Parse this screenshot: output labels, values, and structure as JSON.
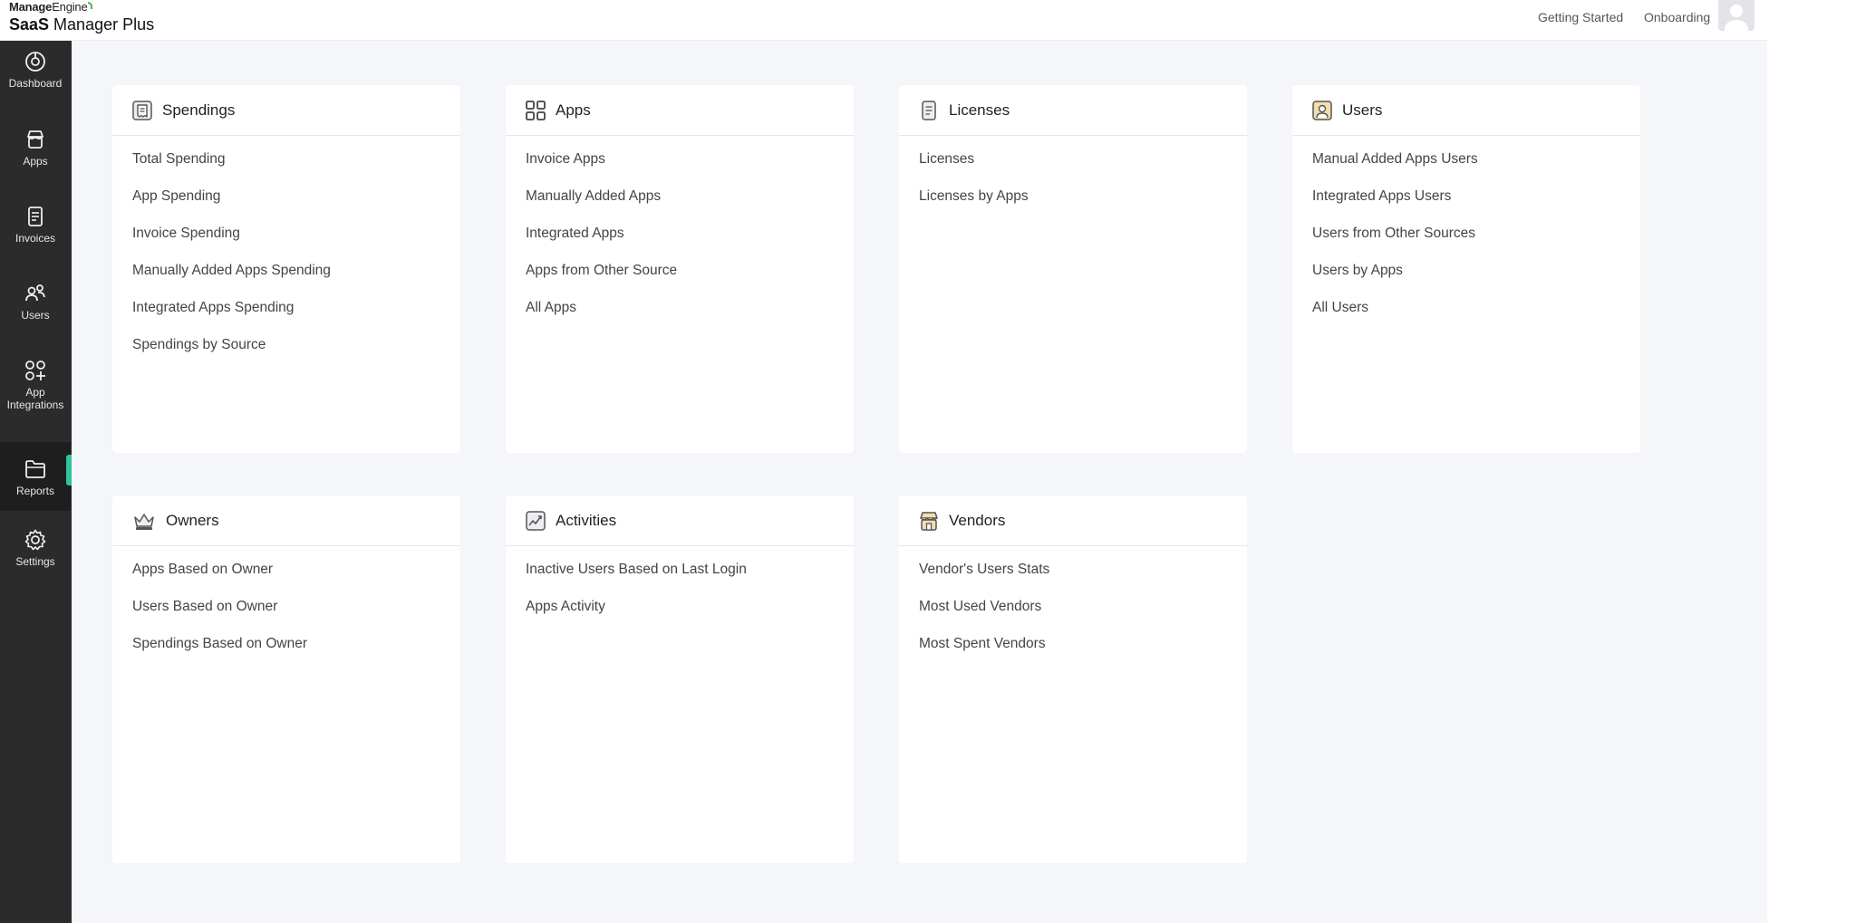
{
  "brand": {
    "vendor_bold": "Manage",
    "vendor_rest": "Engine",
    "product_bold": "SaaS",
    "product_rest": " Manager Plus"
  },
  "header": {
    "links": [
      "Getting Started",
      "Onboarding"
    ]
  },
  "sidebar": {
    "active": "Reports",
    "items": [
      {
        "label": "Dashboard",
        "icon": "dashboard-icon"
      },
      {
        "label": "Apps",
        "icon": "store-icon"
      },
      {
        "label": "Invoices",
        "icon": "invoice-icon"
      },
      {
        "label": "Users",
        "icon": "users-icon"
      },
      {
        "label": "App Integrations",
        "icon": "integrations-icon"
      },
      {
        "label": "Reports",
        "icon": "folder-icon"
      },
      {
        "label": "Settings",
        "icon": "gear-icon"
      }
    ]
  },
  "cards": [
    {
      "title": "Spendings",
      "icon": "receipt-icon",
      "items": [
        "Total Spending",
        "App Spending",
        "Invoice Spending",
        "Manually Added Apps Spending",
        "Integrated Apps Spending",
        "Spendings by Source"
      ]
    },
    {
      "title": "Apps",
      "icon": "grid-icon",
      "items": [
        "Invoice Apps",
        "Manually Added Apps",
        "Integrated Apps",
        "Apps from Other Source",
        "All Apps"
      ]
    },
    {
      "title": "Licenses",
      "icon": "document-icon",
      "items": [
        "Licenses",
        "Licenses by Apps"
      ]
    },
    {
      "title": "Users",
      "icon": "user-card-icon",
      "items": [
        "Manual Added Apps Users",
        "Integrated Apps Users",
        "Users from Other Sources",
        "Users by Apps",
        "All Users"
      ]
    },
    {
      "title": "Owners",
      "icon": "crown-icon",
      "items": [
        "Apps Based on Owner",
        "Users Based on Owner",
        "Spendings Based on Owner"
      ]
    },
    {
      "title": "Activities",
      "icon": "activity-chart-icon",
      "items": [
        "Inactive Users Based on Last Login",
        "Apps Activity"
      ]
    },
    {
      "title": "Vendors",
      "icon": "shop-icon",
      "items": [
        "Vendor's Users Stats",
        "Most Used Vendors",
        "Most Spent Vendors"
      ]
    }
  ],
  "colors": {
    "sidebar_bg": "#2b2b2b",
    "active_indicator": "#2ec4a0",
    "content_bg": "#f5f6fa"
  }
}
